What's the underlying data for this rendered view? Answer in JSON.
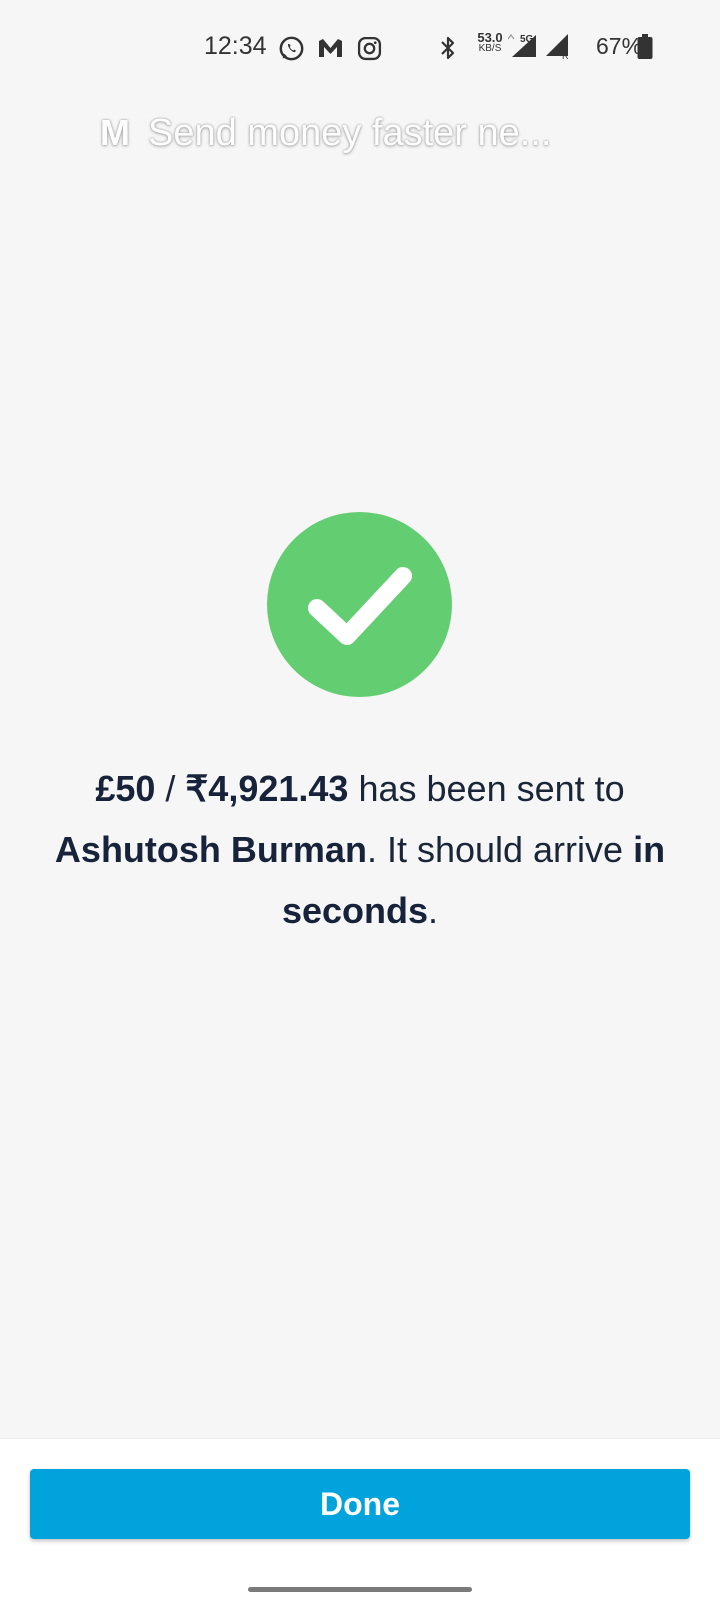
{
  "status_bar": {
    "time": "12:34",
    "net_speed_value": "53.0",
    "net_speed_unit": "KB/S",
    "network_type": "5G",
    "battery_percent": "67%",
    "icons": [
      "whatsapp-icon",
      "m-app-icon",
      "instagram-icon",
      "bluetooth-icon",
      "signal-icon",
      "signal-roaming-icon",
      "battery-icon"
    ]
  },
  "notification": {
    "logo": "M",
    "title": "Send money faster ne..."
  },
  "message": {
    "amount_gbp": "£50",
    "separator": " / ",
    "amount_inr": "₹4,921.43",
    "text1": " has been sent to ",
    "recipient": "Ashutosh Burman",
    "text2": ". It should arrive ",
    "eta": "in seconds",
    "text3": "."
  },
  "actions": {
    "done_label": "Done"
  },
  "colors": {
    "success": "#63cd71",
    "primary": "#00a3db",
    "text": "#1b2538",
    "background": "#f6f6f6"
  }
}
